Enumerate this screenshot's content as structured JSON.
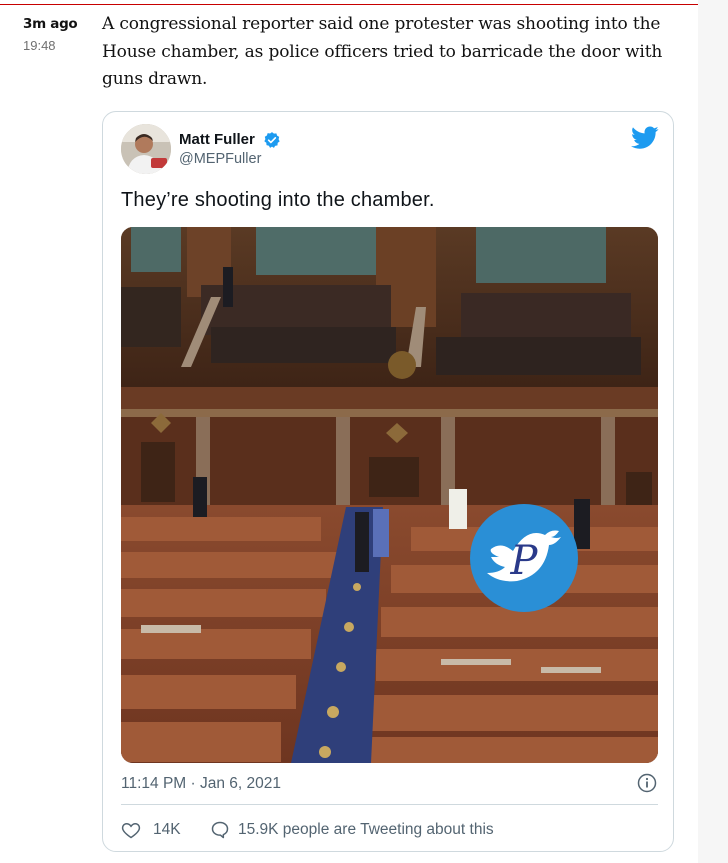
{
  "entry": {
    "time_ago": "3m ago",
    "timestamp": "19:48",
    "text": "A congressional reporter said one protester was shooting into the House chamber, as police officers tried to barricade the door with guns drawn."
  },
  "tweet": {
    "author_name": "Matt Fuller",
    "author_handle": "@MEPFuller",
    "text": "They’re shooting into the chamber.",
    "datetime": "11:14 PM · Jan 6, 2021",
    "likes": "14K",
    "conversation": "15.9K people are Tweeting about this",
    "media_watermark": "P"
  },
  "colors": {
    "accent_rule": "#c70000",
    "twitter_blue": "#1d9bf0",
    "text_secondary": "#536471"
  },
  "icons": {
    "verified": "verified-badge-icon",
    "bird": "twitter-bird-icon",
    "info": "info-icon",
    "like": "heart-icon",
    "reply": "speech-bubble-icon"
  }
}
